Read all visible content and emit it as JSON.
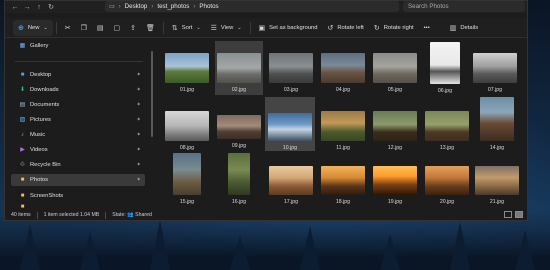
{
  "address": {
    "breadcrumbs": [
      "Desktop",
      "test_photos",
      "Photos"
    ],
    "search_placeholder": "Search Photos"
  },
  "toolbar": {
    "new_label": "New",
    "sort_label": "Sort",
    "view_label": "View",
    "set_background_label": "Set as background",
    "rotate_left_label": "Rotate left",
    "rotate_right_label": "Rotate right",
    "more_label": "•••",
    "details_label": "Details"
  },
  "sidebar": {
    "items": [
      {
        "label": "Gallery",
        "icon": "gallery-icon"
      },
      {
        "label": "Desktop",
        "icon": "desktop-icon"
      },
      {
        "label": "Downloads",
        "icon": "downloads-icon"
      },
      {
        "label": "Documents",
        "icon": "documents-icon"
      },
      {
        "label": "Pictures",
        "icon": "pictures-icon"
      },
      {
        "label": "Music",
        "icon": "music-icon"
      },
      {
        "label": "Videos",
        "icon": "videos-icon"
      },
      {
        "label": "Recycle Bin",
        "icon": "recycle-bin-icon"
      },
      {
        "label": "Photos",
        "icon": "folder-icon"
      },
      {
        "label": "ScreenShots",
        "icon": "folder-icon"
      }
    ]
  },
  "files": [
    {
      "name": "01.jpg"
    },
    {
      "name": "02.jpg"
    },
    {
      "name": "03.jpg"
    },
    {
      "name": "04.jpg"
    },
    {
      "name": "05.jpg"
    },
    {
      "name": "06.jpg"
    },
    {
      "name": "07.jpg"
    },
    {
      "name": "08.jpg"
    },
    {
      "name": "09.jpg"
    },
    {
      "name": "10.jpg"
    },
    {
      "name": "11.jpg"
    },
    {
      "name": "12.jpg"
    },
    {
      "name": "13.jpg"
    },
    {
      "name": "14.jpg"
    },
    {
      "name": "15.jpg"
    },
    {
      "name": "16.jpg"
    },
    {
      "name": "17.jpg"
    },
    {
      "name": "18.jpg"
    },
    {
      "name": "19.jpg"
    },
    {
      "name": "20.jpg"
    },
    {
      "name": "21.jpg"
    }
  ],
  "status": {
    "item_count": "40 items",
    "selection": "1 item selected  1.04 MB",
    "state": "State: 👥 Shared"
  }
}
